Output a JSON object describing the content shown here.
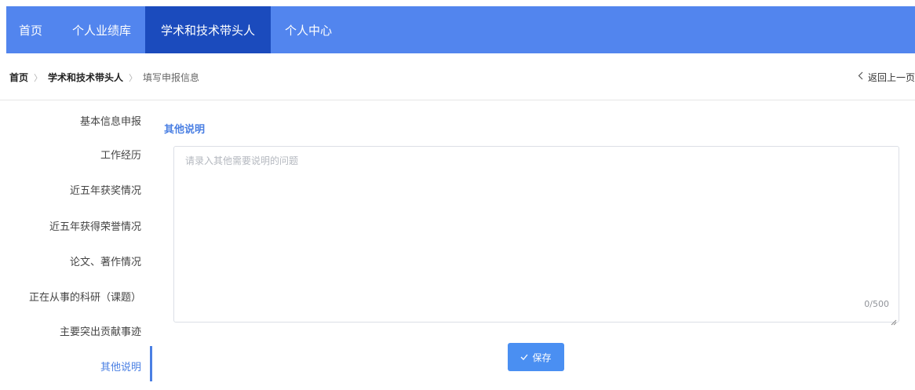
{
  "nav": {
    "items": [
      {
        "label": "首页"
      },
      {
        "label": "个人业绩库"
      },
      {
        "label": "学术和技术带头人"
      },
      {
        "label": "个人中心"
      }
    ],
    "active_index": 2,
    "color": "#5285ee",
    "active_color": "#1b4bbd"
  },
  "breadcrumb": {
    "home": "首页",
    "parent": "学术和技术带头人",
    "current": "填写申报信息",
    "separator": "〉"
  },
  "back": {
    "label": "返回上一页",
    "icon": "chevron-left-icon"
  },
  "sidebar": {
    "items": [
      {
        "label": "基本信息申报"
      },
      {
        "label": "工作经历"
      },
      {
        "label": "近五年获奖情况"
      },
      {
        "label": "近五年获得荣誉情况"
      },
      {
        "label": "论文、著作情况"
      },
      {
        "label": "正在从事的科研（课题）"
      },
      {
        "label": "主要突出贡献事迹"
      },
      {
        "label": "其他说明"
      }
    ],
    "active_index": 7,
    "accent": "#4a7fe3"
  },
  "main": {
    "section_title": "其他说明",
    "textarea": {
      "placeholder": "请录入其他需要说明的问题",
      "value": "",
      "char_count": "0/500"
    },
    "save_button": {
      "label": "保存",
      "icon": "check-icon",
      "color": "#4a8ff2"
    }
  }
}
